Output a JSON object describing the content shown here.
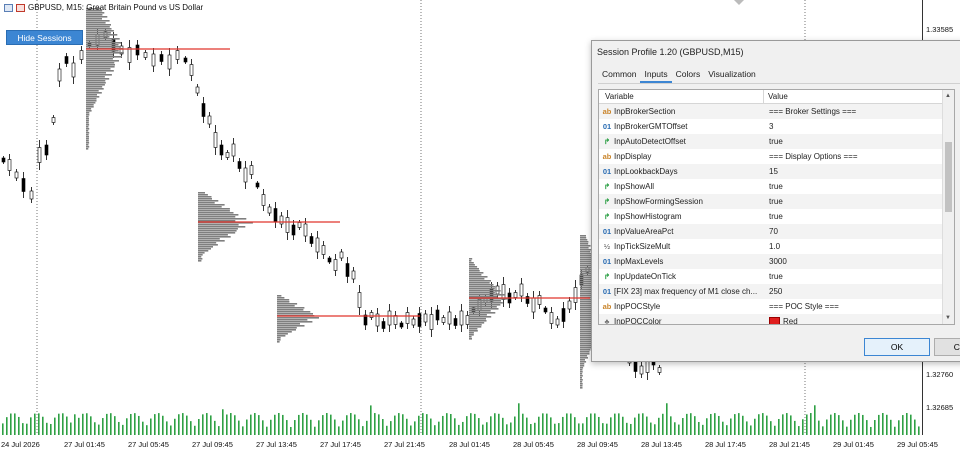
{
  "chart": {
    "title": "GBPUSD, M15:  Great Britain Pound vs US Dollar",
    "hide_sessions_label": "Hide Sessions",
    "price_labels": [
      "1.33585",
      "1.32760",
      "1.32685"
    ],
    "time_labels": [
      "24 Jul 2026",
      "27 Jul 01:45",
      "27 Jul 05:45",
      "27 Jul 09:45",
      "27 Jul 13:45",
      "27 Jul 17:45",
      "27 Jul 21:45",
      "28 Jul 01:45",
      "28 Jul 05:45",
      "28 Jul 09:45",
      "28 Jul 13:45",
      "28 Jul 17:45",
      "28 Jul 21:45",
      "29 Jul 01:45",
      "29 Jul 05:45"
    ],
    "poc_color": "#e0342c",
    "histogram_color": "#7f7f7f"
  },
  "dialog": {
    "title": "Session Profile 1.20 (GBPUSD,M15)",
    "tabs": [
      "Common",
      "Inputs",
      "Colors",
      "Visualization"
    ],
    "active_tab": "Inputs",
    "col_variable": "Variable",
    "col_value": "Value",
    "rows": [
      {
        "icon": "ab",
        "var": "InpBrokerSection",
        "val": "=== Broker Settings ==="
      },
      {
        "icon": "01",
        "var": "InpBrokerGMTOffset",
        "val": "3"
      },
      {
        "icon": "bool",
        "var": "InpAutoDetectOffset",
        "val": "true"
      },
      {
        "icon": "ab",
        "var": "InpDisplay",
        "val": "=== Display Options ==="
      },
      {
        "icon": "01",
        "var": "InpLookbackDays",
        "val": "15"
      },
      {
        "icon": "bool",
        "var": "InpShowAll",
        "val": "true"
      },
      {
        "icon": "bool",
        "var": "InpShowFormingSession",
        "val": "true"
      },
      {
        "icon": "bool",
        "var": "InpShowHistogram",
        "val": "true"
      },
      {
        "icon": "01",
        "var": "InpValueAreaPct",
        "val": "70"
      },
      {
        "icon": "half",
        "var": "InpTickSizeMult",
        "val": "1.0"
      },
      {
        "icon": "01",
        "var": "InpMaxLevels",
        "val": "3000"
      },
      {
        "icon": "bool",
        "var": "InpUpdateOnTick",
        "val": "true"
      },
      {
        "icon": "01",
        "var": "[FIX 23] max frequency of M1 close ch...",
        "val": "250"
      },
      {
        "icon": "ab",
        "var": "InpPOCStyle",
        "val": "=== POC Style ==="
      },
      {
        "icon": "color",
        "var": "InpPOCColor",
        "val": "Red"
      }
    ],
    "ok_label": "OK",
    "cancel_label": "Cancel"
  }
}
